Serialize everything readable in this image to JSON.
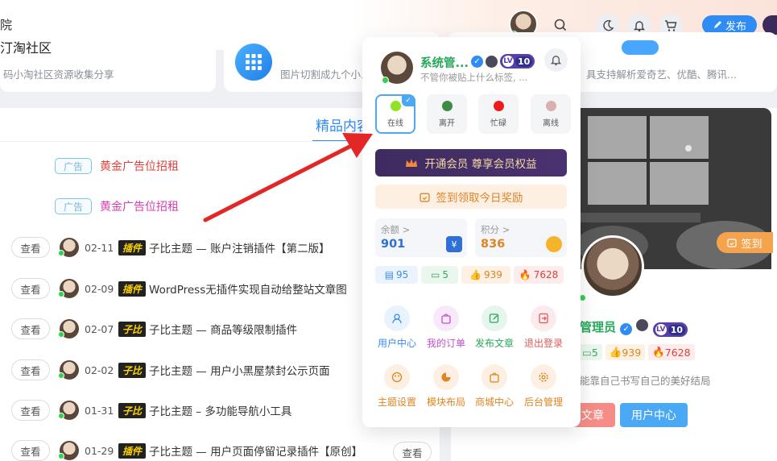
{
  "header": {
    "site_fragment": "院",
    "publish_label": "发布"
  },
  "cards": [
    {
      "title": "码小淘社区资源收集分享"
    },
    {
      "desc": "图片切割成九个小..."
    },
    {
      "desc": "具支持解析爱奇艺、优酷、腾讯..."
    }
  ],
  "main": {
    "tab_label": "精品内容",
    "ads": [
      {
        "badge": "广告",
        "text": "黄金广告位招租",
        "color": "#e0413b"
      },
      {
        "badge": "广告",
        "text": "黄金广告位招租",
        "color": "#d63fb0"
      }
    ],
    "view_label": "查看",
    "rows": [
      {
        "date": "02-11",
        "tag": "插件",
        "title": "子比主题 — 账户注销插件【第二版】"
      },
      {
        "date": "02-09",
        "tag": "插件",
        "title": "WordPress无插件实现自动给整站文章图"
      },
      {
        "date": "02-07",
        "tag": "子比",
        "title": "子比主题 — 商品等级限制插件"
      },
      {
        "date": "02-02",
        "tag": "子比",
        "title": "子比主题 — 用户小黑屋禁封公示页面"
      },
      {
        "date": "01-31",
        "tag": "子比",
        "title": "子比主题 – 多功能导航小工具"
      },
      {
        "date": "01-29",
        "tag": "插件",
        "title": "子比主题 — 用户页面停留记录插件【原创】"
      }
    ]
  },
  "right_card": {
    "checkin_label": "签到",
    "name": "管理员",
    "level": "10",
    "stats": [
      "5",
      "939",
      "7628"
    ],
    "desc": "能靠自己书写自己的美好结局",
    "btn_a": "文章",
    "btn_b": "用户中心"
  },
  "dropdown": {
    "name": "系统管...",
    "level": "10",
    "signature": "不管你被贴上什么标签, ...",
    "statuses": [
      {
        "label": "在线",
        "color": "#8fe31f"
      },
      {
        "label": "离开",
        "color": "#3d8b45"
      },
      {
        "label": "忙碌",
        "color": "#ef1b1b"
      },
      {
        "label": "离线",
        "color": "#d9b0b0"
      }
    ],
    "vip_label": "开通会员 尊享会员权益",
    "sign_label": "签到领取今日奖励",
    "wallet": [
      {
        "label": "余额 >",
        "value": "901",
        "color": "#2f6fd6"
      },
      {
        "label": "积分 >",
        "value": "836",
        "color": "#e0841f"
      }
    ],
    "chips": [
      {
        "value": "95",
        "color": "#3d8de8",
        "bg": "#ebf4fd"
      },
      {
        "value": "5",
        "color": "#3aa65a",
        "bg": "#eaf7ee"
      },
      {
        "value": "939",
        "color": "#e08424",
        "bg": "#fdf1e3"
      },
      {
        "value": "7628",
        "color": "#e0413b",
        "bg": "#fdecec"
      }
    ],
    "menu": [
      {
        "label": "用户中心",
        "color": "#3d8de8",
        "bg": "#e8f3fd"
      },
      {
        "label": "我的订单",
        "color": "#c44fd0",
        "bg": "#f8e9fa"
      },
      {
        "label": "发布文章",
        "color": "#27a85a",
        "bg": "#e6f6ec"
      },
      {
        "label": "退出登录",
        "color": "#e05a5a",
        "bg": "#fcebec"
      },
      {
        "label": "主题设置",
        "color": "#e0841f",
        "bg": "#fdf0e2"
      },
      {
        "label": "模块布局",
        "color": "#e0841f",
        "bg": "#fdf0e2"
      },
      {
        "label": "商城中心",
        "color": "#e0841f",
        "bg": "#fdf0e2"
      },
      {
        "label": "后台管理",
        "color": "#e0841f",
        "bg": "#fdf0e2"
      }
    ]
  },
  "colors": {
    "accent": "#2f8cf4",
    "online": "#2fd24a",
    "name_green": "#27a85a",
    "arrow": "#e32626"
  }
}
